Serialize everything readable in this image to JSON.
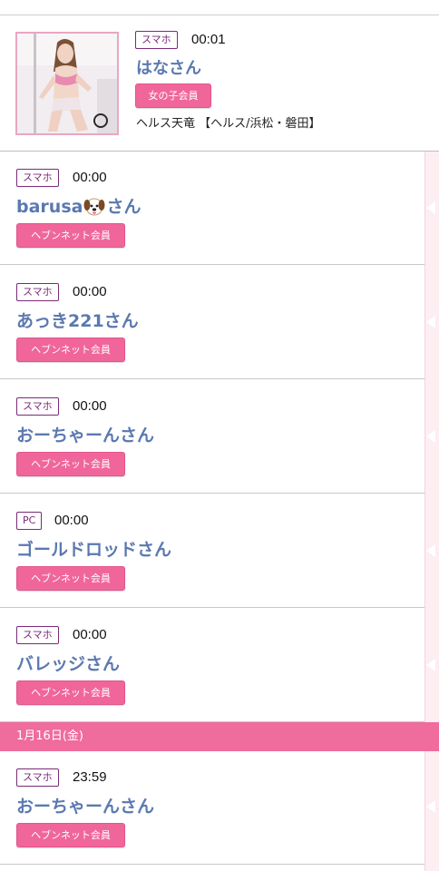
{
  "featured": {
    "device": "スマホ",
    "time": "00:01",
    "name": "はなさん",
    "member_type": "女の子会員",
    "shop": "ヘルス天竜 【ヘルス/浜松・磐田】"
  },
  "visitors": [
    {
      "device": "スマホ",
      "time": "00:00",
      "name_prefix": "barusa",
      "name_icon": "dog-emoji-icon",
      "name_suffix": "さん",
      "member_type": "ヘブンネット会員"
    },
    {
      "device": "スマホ",
      "time": "00:00",
      "name": "あっき221さん",
      "member_type": "ヘブンネット会員"
    },
    {
      "device": "スマホ",
      "time": "00:00",
      "name": "おーちゃーんさん",
      "member_type": "ヘブンネット会員"
    },
    {
      "device": "PC",
      "time": "00:00",
      "name": "ゴールドロッドさん",
      "member_type": "ヘブンネット会員"
    },
    {
      "device": "スマホ",
      "time": "00:00",
      "name": "バレッジさん",
      "member_type": "ヘブンネット会員"
    }
  ],
  "date_header": "1月16日(金)",
  "visitors_after_date": [
    {
      "device": "スマホ",
      "time": "23:59",
      "name": "おーちゃーんさん",
      "member_type": "ヘブンネット会員"
    }
  ],
  "colors": {
    "accent_pink": "#f0669b",
    "device_badge": "#7b2a7a",
    "name_blue": "#5b79b0",
    "side_strip": "#fdeef2"
  }
}
